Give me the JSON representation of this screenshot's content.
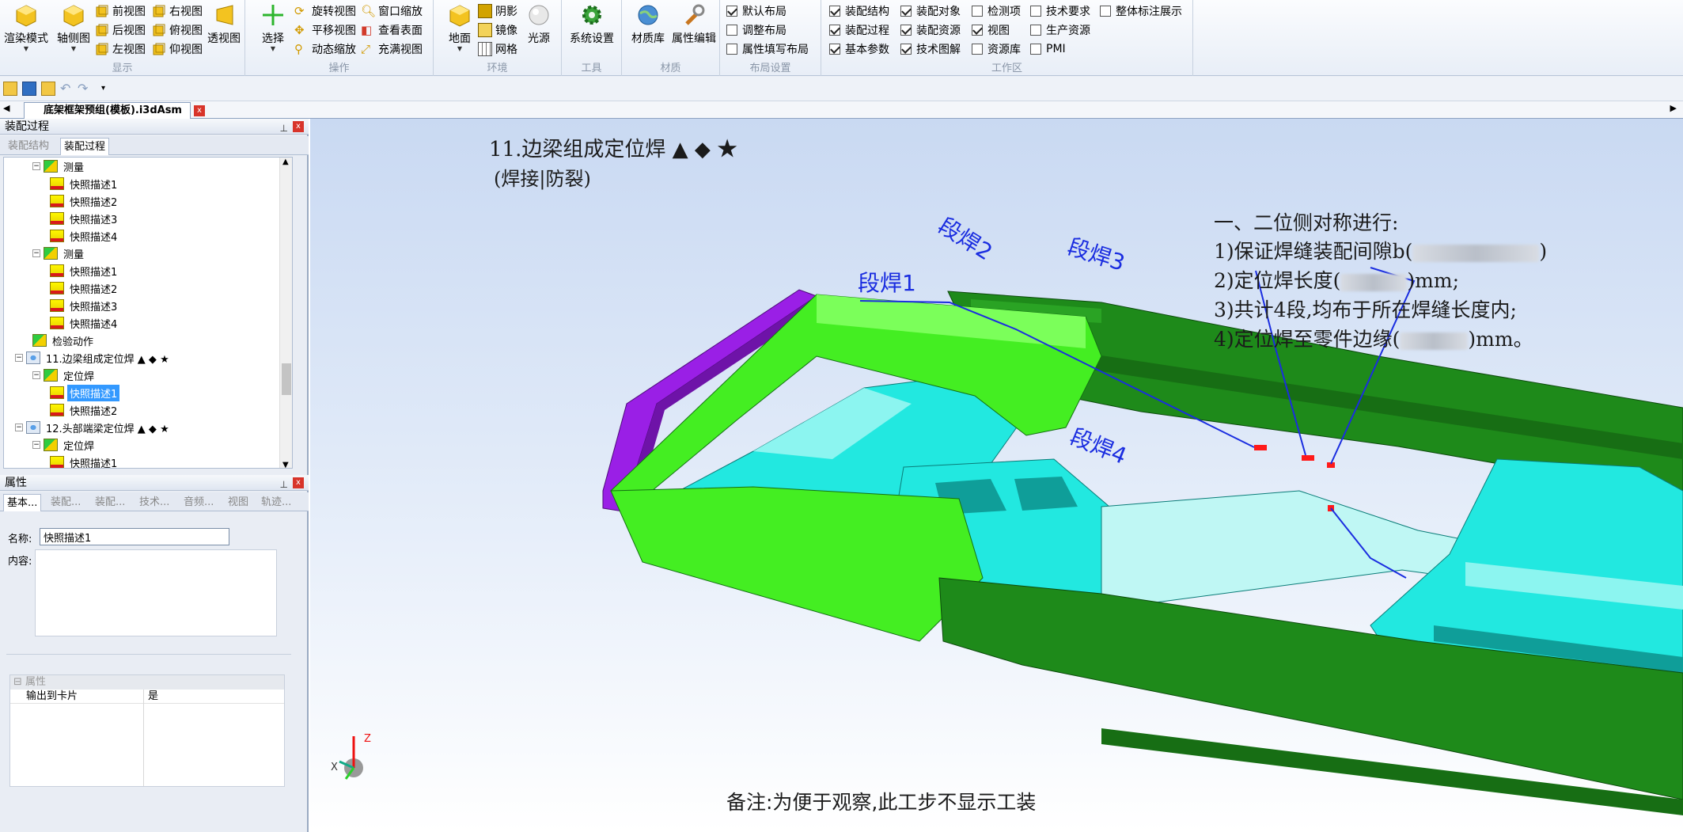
{
  "ribbon": {
    "display": {
      "caption": "显示",
      "render_mode": "渲染模式",
      "axis_view": "轴侧图",
      "front_view": "前视图",
      "back_view": "后视图",
      "left_view": "左视图",
      "right_view": "右视图",
      "top_view": "俯视图",
      "bottom_view": "仰视图",
      "perspective": "透视图"
    },
    "operate": {
      "caption": "操作",
      "select": "选择",
      "rotate_view": "旋转视图",
      "pan_view": "平移视图",
      "dynamic_zoom": "动态缩放",
      "window_zoom": "窗口缩放",
      "view_surface": "查看表面",
      "fit_view": "充满视图"
    },
    "environment": {
      "caption": "环境",
      "ground": "地面",
      "shadow": "阴影",
      "mirror": "镜像",
      "grid": "网格",
      "light": "光源"
    },
    "tools": {
      "caption": "工具",
      "system_settings": "系统设置"
    },
    "material": {
      "caption": "材质",
      "material_lib": "材质库",
      "attr_edit": "属性编辑"
    },
    "layout": {
      "caption": "布局设置",
      "items": [
        {
          "label": "默认布局",
          "checked": true
        },
        {
          "label": "调整布局",
          "checked": false
        },
        {
          "label": "属性填写布局",
          "checked": false
        }
      ]
    },
    "workspace": {
      "caption": "工作区",
      "items": [
        {
          "label": "装配结构",
          "checked": true
        },
        {
          "label": "装配过程",
          "checked": true
        },
        {
          "label": "基本参数",
          "checked": true
        },
        {
          "label": "装配对象",
          "checked": true
        },
        {
          "label": "装配资源",
          "checked": true
        },
        {
          "label": "技术图解",
          "checked": true
        },
        {
          "label": "检测项",
          "checked": false
        },
        {
          "label": "视图",
          "checked": true
        },
        {
          "label": "资源库",
          "checked": false
        },
        {
          "label": "技术要求",
          "checked": false
        },
        {
          "label": "生产资源",
          "checked": false
        },
        {
          "label": "PMI",
          "checked": false
        },
        {
          "label": "整体标注展示",
          "checked": false
        }
      ]
    }
  },
  "document": {
    "tab_title": "底架框架预组(模板).i3dAsm",
    "close": "x"
  },
  "assembly_panel": {
    "title": "装配过程",
    "tabs": [
      "装配结构",
      "装配过程"
    ],
    "tree": [
      {
        "level": 2,
        "label": "测量",
        "type": "group",
        "expanded": true
      },
      {
        "level": 3,
        "label": "快照描述1",
        "type": "snapshot"
      },
      {
        "level": 3,
        "label": "快照描述2",
        "type": "snapshot"
      },
      {
        "level": 3,
        "label": "快照描述3",
        "type": "snapshot"
      },
      {
        "level": 3,
        "label": "快照描述4",
        "type": "snapshot"
      },
      {
        "level": 2,
        "label": "测量",
        "type": "group",
        "expanded": true
      },
      {
        "level": 3,
        "label": "快照描述1",
        "type": "snapshot"
      },
      {
        "level": 3,
        "label": "快照描述2",
        "type": "snapshot"
      },
      {
        "level": 3,
        "label": "快照描述3",
        "type": "snapshot"
      },
      {
        "level": 3,
        "label": "快照描述4",
        "type": "snapshot"
      },
      {
        "level": 2,
        "label": "检验动作",
        "type": "action"
      },
      {
        "level": 1,
        "label": "11.边梁组成定位焊 ▲ ◆ ★",
        "type": "step",
        "expanded": true
      },
      {
        "level": 2,
        "label": "定位焊",
        "type": "group",
        "expanded": true
      },
      {
        "level": 3,
        "label": "快照描述1",
        "type": "snapshot",
        "selected": true
      },
      {
        "level": 3,
        "label": "快照描述2",
        "type": "snapshot"
      },
      {
        "level": 1,
        "label": "12.头部端梁定位焊 ▲ ◆ ★",
        "type": "step",
        "expanded": true
      },
      {
        "level": 2,
        "label": "定位焊",
        "type": "group",
        "expanded": true
      },
      {
        "level": 3,
        "label": "快照描述1",
        "type": "snapshot"
      }
    ]
  },
  "properties_panel": {
    "title": "属性",
    "tabs": [
      "基本...",
      "装配...",
      "装配...",
      "技术...",
      "音频...",
      "视图",
      "轨迹..."
    ],
    "name_label": "名称:",
    "name_value": "快照描述1",
    "content_label": "内容:",
    "grid": {
      "category": "属性",
      "rows": [
        {
          "key": "输出到卡片",
          "value": "是"
        }
      ]
    }
  },
  "viewport": {
    "step_title": "11.边梁组成定位焊 ▲ ◆ ★",
    "step_subtitle": "(焊接|防裂)",
    "instructions": {
      "heading": "一、二位侧对称进行:",
      "line1_pre": "1)保证焊缝装配间隙b(",
      "line1_post": ")",
      "line2_pre": "2)定位焊长度(",
      "line2_post": ")mm;",
      "line3": "3)共计4段,均布于所在焊缝长度内;",
      "line4_pre": "4)定位焊至零件边缘(",
      "line4_post": ")mm。"
    },
    "callouts": [
      "段焊1",
      "段焊2",
      "段焊3",
      "段焊4"
    ],
    "note": "备注:为便于观察,此工步不显示工装",
    "axis_labels": {
      "x": "X",
      "z": "Z"
    },
    "colors": {
      "rail_light": "#44ee22",
      "rail_dark": "#1e8a1a",
      "frame_cyan": "#22e8e0",
      "end_beam": "#9a1fe6",
      "weld_mark": "#ff1a1a",
      "callout": "#1a2de0"
    }
  }
}
